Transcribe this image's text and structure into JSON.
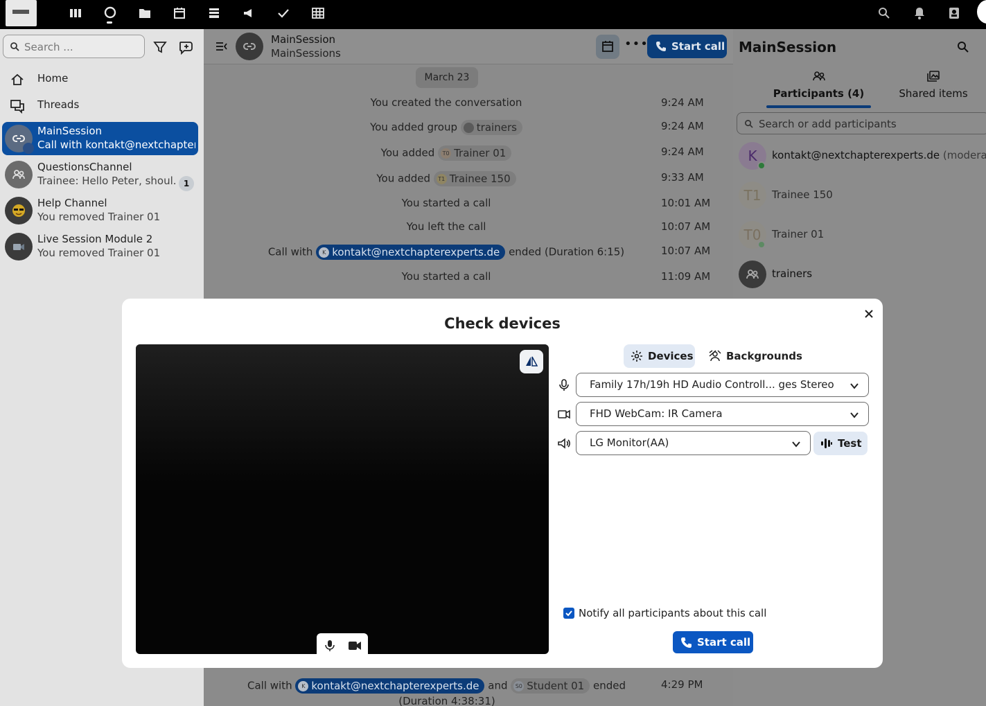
{
  "sidebar": {
    "search_placeholder": "Search ...",
    "nav": [
      {
        "label": "Home",
        "icon": "home-icon"
      },
      {
        "label": "Threads",
        "icon": "threads-icon"
      }
    ],
    "conversations": [
      {
        "title": "MainSession",
        "subtitle": "Call with kontakt@nextchapter...",
        "active": true,
        "icon": "link-icon"
      },
      {
        "title": "QuestionsChannel",
        "subtitle": "Trainee: Hello Peter, shoul...",
        "badge": "1",
        "icon": "group-icon"
      },
      {
        "title": "Help Channel",
        "subtitle": "You removed Trainer 01",
        "icon": "emoji-sunglasses"
      },
      {
        "title": "Live Session Module 2",
        "subtitle": "You removed Trainer 01",
        "icon": "video-camera-icon"
      }
    ]
  },
  "chat": {
    "title": "MainSession",
    "subtitle": "MainSessions",
    "start_call": "Start call",
    "date": "March 23",
    "messages": [
      {
        "pre": "You created the conversation",
        "time": "9:24 AM"
      },
      {
        "pre": "You added group",
        "chip": "trainers",
        "time": "9:24 AM"
      },
      {
        "pre": "You added",
        "chip": "Trainer 01",
        "chip_initials": "T0",
        "time": "9:24 AM"
      },
      {
        "pre": "You added",
        "chip": "Trainee 150",
        "chip_initials": "T1",
        "time": "9:33 AM"
      },
      {
        "pre": "You started a call",
        "time": "10:01 AM"
      },
      {
        "pre": "You left the call",
        "time": "10:07 AM"
      },
      {
        "pre": "Call with",
        "chip": "kontakt@nextchapterexperts.de",
        "chip_initials": "K",
        "post": "ended (Duration 6:15)",
        "time": "10:07 AM"
      },
      {
        "pre": "You started a call",
        "time": "11:09 AM"
      }
    ],
    "bottom_message": {
      "pre": "Call with",
      "chip1": "kontakt@nextchapterexperts.de",
      "chip1_initials": "K",
      "mid": "and",
      "chip2": "Student 01",
      "chip2_initials": "S0",
      "post": "ended",
      "line2": "(Duration 4:38:31)",
      "time": "4:29 PM"
    }
  },
  "rpanel": {
    "title": "MainSession",
    "tabs": [
      {
        "label": "Participants (4)",
        "icon": "participants-icon",
        "active": true
      },
      {
        "label": "Shared items",
        "icon": "shared-items-icon",
        "active": false
      }
    ],
    "search_placeholder": "Search or add participants",
    "participants": [
      {
        "initials": "K",
        "name": "kontakt@nextchapterexperts.de",
        "suffix": "(moderator)",
        "online": true
      },
      {
        "initials": "T1",
        "name": "Trainee 150",
        "online": false
      },
      {
        "initials": "T0",
        "name": "Trainer 01",
        "online": true
      },
      {
        "initials": "",
        "name": "trainers",
        "group": true
      }
    ]
  },
  "modal": {
    "title": "Check devices",
    "tabs": [
      {
        "label": "Devices",
        "icon": "gear-icon",
        "active": true
      },
      {
        "label": "Backgrounds",
        "icon": "background-icon",
        "active": false
      }
    ],
    "microphone": "Family 17h/19h HD Audio Controll...  ges Stereo",
    "camera": "FHD WebCam: IR Camera",
    "speaker": "LG Monitor(AA)",
    "test_label": "Test",
    "notify_label": "Notify all participants about this call",
    "notify_checked": true,
    "start_call": "Start call"
  },
  "colors": {
    "accent": "#0b57c2",
    "accent_dark": "#0a3d7a",
    "topbar": "#000000",
    "overlay": "#8c8c8c"
  }
}
